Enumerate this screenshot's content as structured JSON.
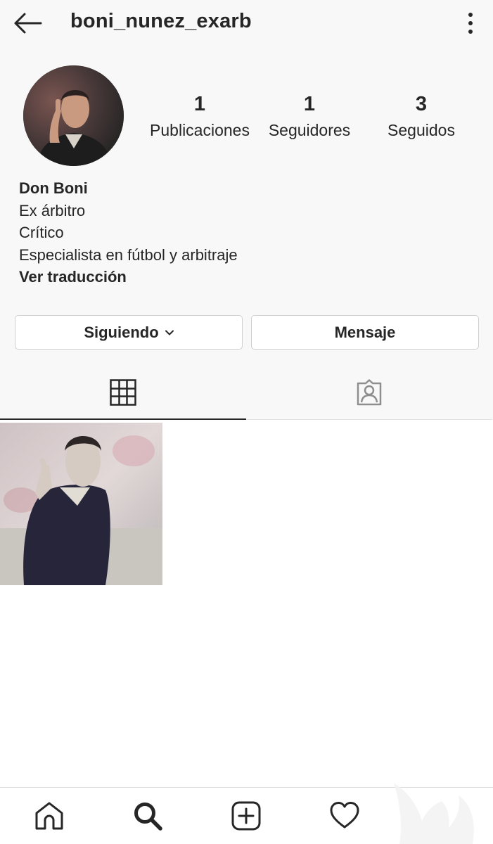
{
  "header": {
    "username": "boni_nunez_exarb",
    "back_icon": "arrow-left-icon",
    "more_icon": "more-vertical-icon"
  },
  "profile": {
    "stats": [
      {
        "value": "1",
        "label": "Publicaciones"
      },
      {
        "value": "1",
        "label": "Seguidores"
      },
      {
        "value": "3",
        "label": "Seguidos"
      }
    ],
    "bio": {
      "name": "Don Boni",
      "lines": [
        "Ex árbitro",
        "Crítico",
        "Especialista en fútbol y arbitraje"
      ],
      "translate_link": "Ver traducción"
    }
  },
  "actions": {
    "following_label": "Siguiendo",
    "message_label": "Mensaje"
  },
  "tabs": [
    {
      "name": "grid",
      "icon": "grid-icon",
      "active": true
    },
    {
      "name": "tagged",
      "icon": "tagged-person-icon",
      "active": false
    }
  ],
  "bottom_nav": [
    "home-icon",
    "search-icon",
    "add-post-icon",
    "heart-icon"
  ],
  "colors": {
    "text": "#262626",
    "top_background": "#f8f8f8",
    "button_border": "#cfcfcf",
    "divider": "#dbdbdb"
  }
}
